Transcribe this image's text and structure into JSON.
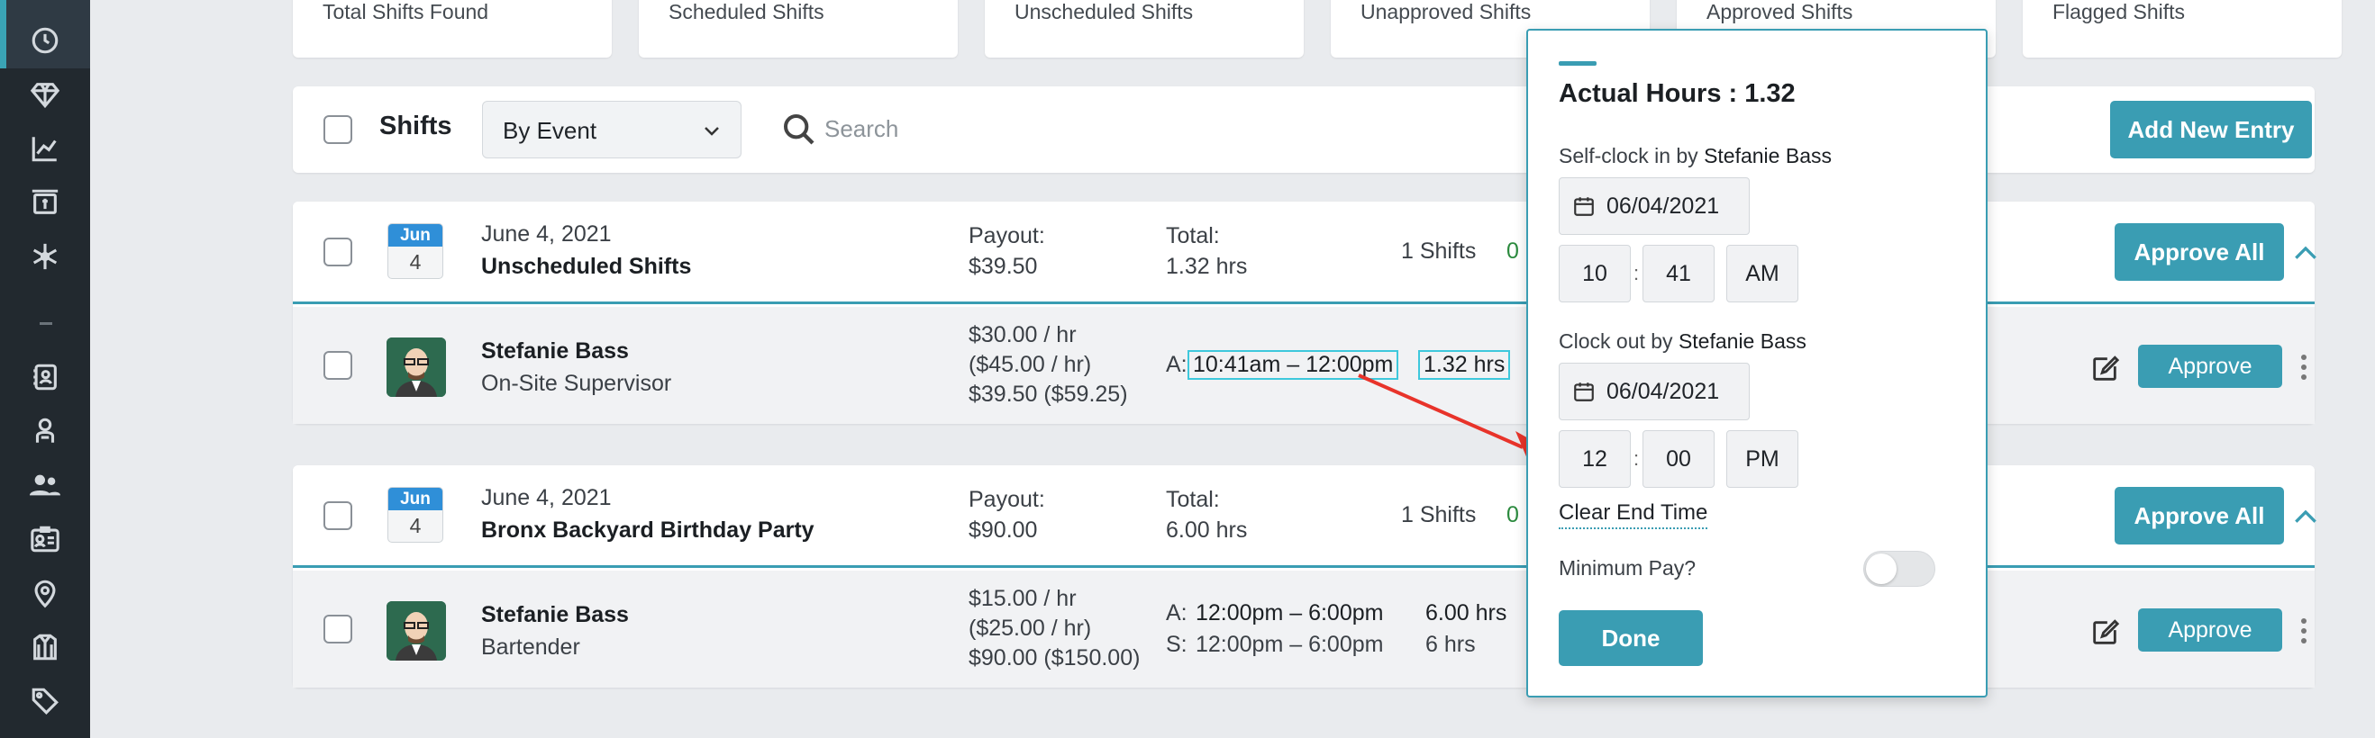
{
  "summary_cards": [
    "Total Shifts Found",
    "Scheduled Shifts",
    "Unscheduled Shifts",
    "Unapproved Shifts",
    "Approved Shifts",
    "Flagged Shifts"
  ],
  "toolbar": {
    "title": "Shifts",
    "group_by": "By Event",
    "search_placeholder": "Search",
    "add_button": "Add New Entry"
  },
  "groups": [
    {
      "month": "Jun",
      "day": "4",
      "date": "June 4, 2021",
      "name": "Unscheduled Shifts",
      "payout_label": "Payout:",
      "payout": "$39.50",
      "total_label": "Total:",
      "total": "1.32 hrs",
      "shifts": "1 Shifts",
      "count_partial": "0 .",
      "approve_all": "Approve All",
      "row": {
        "name": "Stefanie Bass",
        "role": "On-Site Supervisor",
        "rate1": "$30.00 / hr",
        "rate2": "($45.00 / hr)",
        "rate3": "$39.50 ($59.25)",
        "a_label": "A:",
        "a_time": "10:41am – 12:00pm",
        "a_hrs": "1.32 hrs",
        "approve": "Approve"
      }
    },
    {
      "month": "Jun",
      "day": "4",
      "date": "June 4, 2021",
      "name": "Bronx Backyard Birthday Party",
      "payout_label": "Payout:",
      "payout": "$90.00",
      "total_label": "Total:",
      "total": "6.00 hrs",
      "shifts": "1 Shifts",
      "count_partial": "0 .",
      "approve_all": "Approve All",
      "row": {
        "name": "Stefanie Bass",
        "role": "Bartender",
        "rate1": "$15.00 / hr",
        "rate2": "($25.00 / hr)",
        "rate3": "$90.00 ($150.00)",
        "a_label": "A:",
        "a_time": "12:00pm – 6:00pm",
        "a_hrs": "6.00 hrs",
        "s_label": "S:",
        "s_time": "12:00pm – 6:00pm",
        "s_hrs": "6 hrs",
        "approve": "Approve"
      }
    }
  ],
  "popup": {
    "title": "Actual Hours : 1.32",
    "clock_in_label": "Self-clock in by",
    "clock_in_person": "Stefanie Bass",
    "clock_in_date": "06/04/2021",
    "clock_in_hour": "10",
    "clock_in_min": "41",
    "clock_in_ampm": "AM",
    "clock_out_label": "Clock out by",
    "clock_out_person": "Stefanie Bass",
    "clock_out_date": "06/04/2021",
    "clock_out_hour": "12",
    "clock_out_min": "00",
    "clock_out_ampm": "PM",
    "clear_end": "Clear End Time",
    "min_pay_label": "Minimum Pay?",
    "min_pay_on": false,
    "done": "Done",
    "colon": ":"
  },
  "colors": {
    "accent": "#3a9db3",
    "sidebar": "#22292f",
    "annotation_arrow": "#e8332a",
    "highlight": "#3ec8dc"
  },
  "sidebar_icons": [
    "clock-icon",
    "diamond-icon",
    "chart-line-icon",
    "invoice-icon",
    "snowflake-icon",
    "contacts-icon",
    "staff-icon",
    "people-icon",
    "id-card-icon",
    "location-pin-icon",
    "uniform-icon",
    "tag-icon"
  ]
}
